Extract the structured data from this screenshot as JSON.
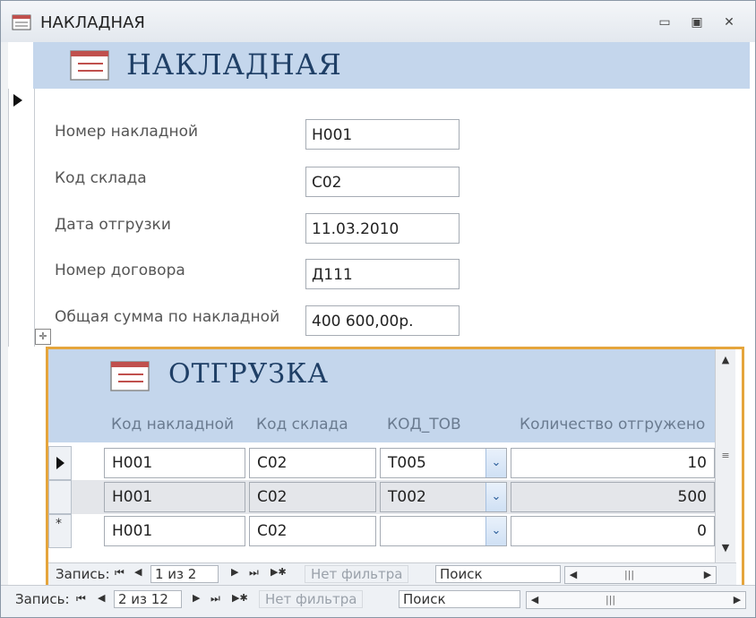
{
  "window": {
    "title": "НАКЛАДНАЯ",
    "controls": {
      "minimize": "▭",
      "restore": "▣",
      "close": "✕"
    }
  },
  "form": {
    "header_title": "НАКЛАДНАЯ",
    "fields": [
      {
        "label": "Номер накладной",
        "value": "Н001"
      },
      {
        "label": "Код склада",
        "value": "С02"
      },
      {
        "label": "Дата отгрузки",
        "value": "11.03.2010"
      },
      {
        "label": "Номер договора",
        "value": "Д111"
      },
      {
        "label": "Общая сумма по накладной",
        "value": "400 600,00р."
      }
    ]
  },
  "subform": {
    "title": "ОТГРУЗКА",
    "columns": [
      "Код накладной",
      "Код склада",
      "КОД_ТОВ",
      "Количество отгружено"
    ],
    "rows": [
      {
        "selector": "current",
        "cells": [
          "Н001",
          "С02",
          "Т005",
          "10"
        ]
      },
      {
        "selector": "none",
        "cells": [
          "Н001",
          "С02",
          "Т002",
          "500"
        ]
      },
      {
        "selector": "new",
        "cells": [
          "Н001",
          "С02",
          "",
          "0"
        ]
      }
    ],
    "new_record_marker": "*",
    "nav": {
      "label": "Запись:",
      "current": "1 из 2",
      "filter": "Нет фильтра",
      "search": "Поиск"
    }
  },
  "main_nav": {
    "label": "Запись:",
    "current": "2 из 12",
    "filter": "Нет фильтра",
    "search": "Поиск"
  },
  "icons": {
    "first": "⏮",
    "prev": "◀",
    "next": "▶",
    "last": "⏭",
    "new": "▶✱",
    "dropdown": "⌄",
    "scroll_up": "▲",
    "scroll_down": "▼",
    "scroll_left": "◀",
    "scroll_right": "▶",
    "move_handle": "✛"
  },
  "colors": {
    "header_band": "#c4d6ec",
    "title_text": "#1f3f66",
    "subform_border": "#e5a53c"
  }
}
